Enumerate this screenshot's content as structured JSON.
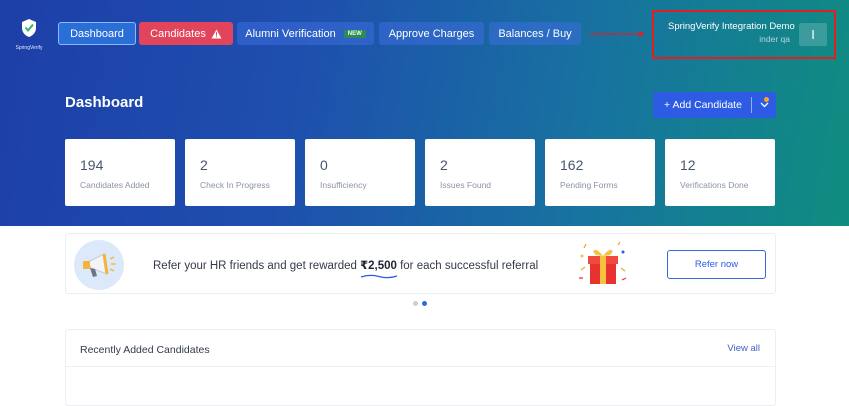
{
  "brand": {
    "logo_text": "SpringVerify"
  },
  "nav": {
    "dashboard": "Dashboard",
    "candidates": "Candidates",
    "alumni_verification": "Alumni Verification",
    "alumni_badge": "NEW",
    "approve_charges": "Approve Charges",
    "balances_buy": "Balances / Buy"
  },
  "profile": {
    "company": "SpringVerify Integration Demo",
    "user": "inder qa",
    "avatar_initial": "I"
  },
  "page": {
    "title": "Dashboard"
  },
  "actions": {
    "add_candidate": "+ Add Candidate"
  },
  "stats": [
    {
      "value": "194",
      "label": "Candidates Added"
    },
    {
      "value": "2",
      "label": "Check In Progress"
    },
    {
      "value": "0",
      "label": "Insufficiency"
    },
    {
      "value": "2",
      "label": "Issues Found"
    },
    {
      "value": "162",
      "label": "Pending Forms"
    },
    {
      "value": "12",
      "label": "Verifications Done"
    }
  ],
  "referral": {
    "text_before": "Refer your HR friends and get rewarded ",
    "amount": "₹2,500",
    "text_after": " for each successful referral",
    "button": "Refer now"
  },
  "carousel": {
    "slides": 2,
    "active_index": 1
  },
  "recent": {
    "title": "Recently Added Candidates",
    "view_all": "View all"
  },
  "colors": {
    "candidates_button": "#e2445c",
    "primary": "#2d5be3",
    "annotation_red": "#e02020"
  },
  "icons": {
    "warning": "warning-icon",
    "chevron": "chevron-down-icon",
    "megaphone": "megaphone-icon",
    "gift": "gift-icon"
  }
}
